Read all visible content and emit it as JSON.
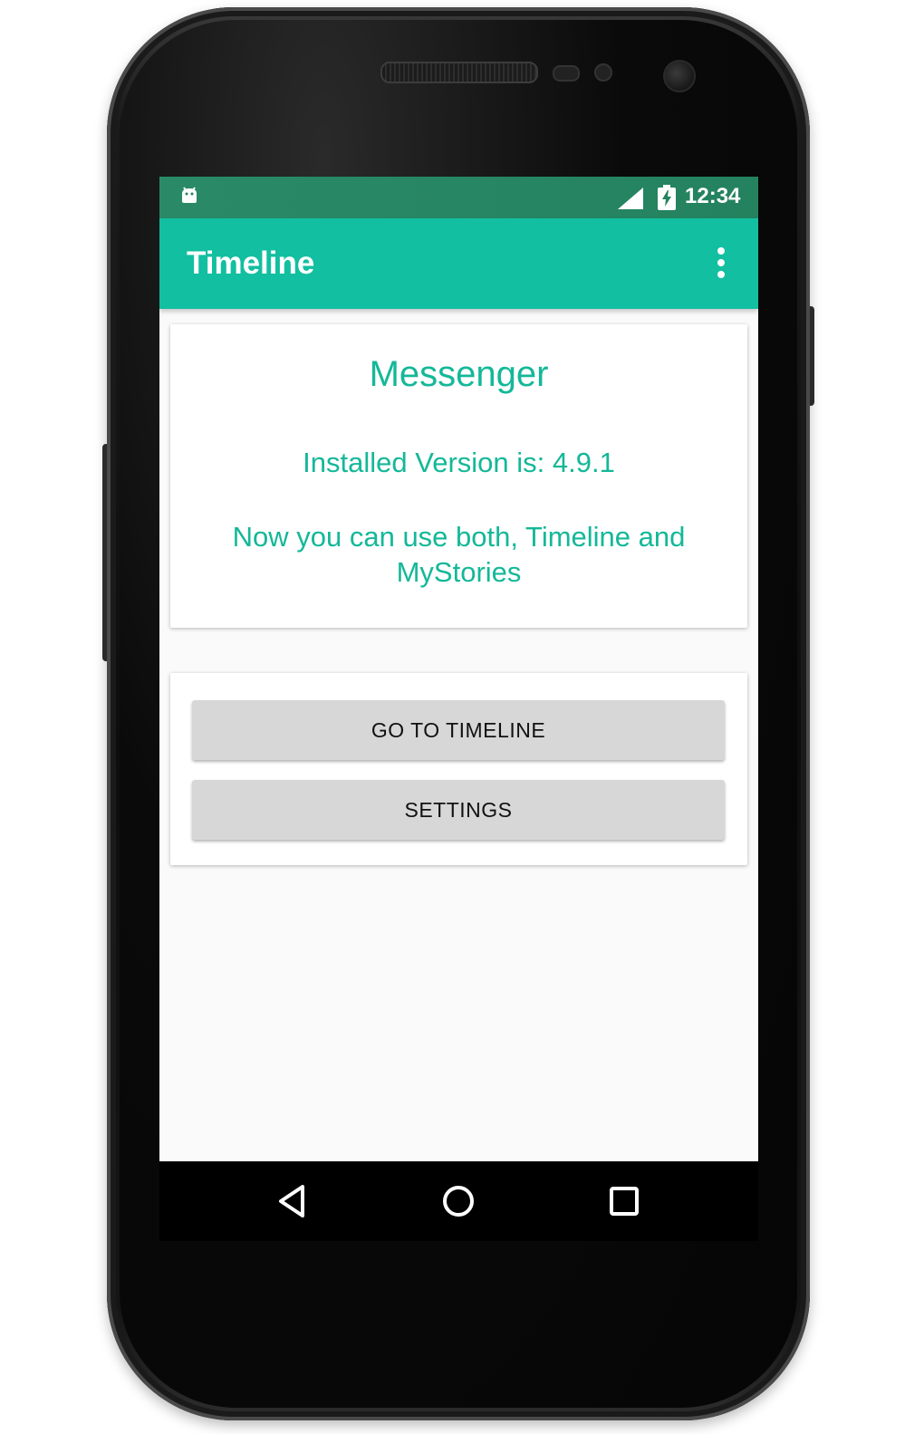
{
  "status_bar": {
    "time": "12:34",
    "notification_icon": "android-debug-icon",
    "signal_icon": "cell-signal-icon",
    "battery_icon": "battery-charging-icon"
  },
  "app_bar": {
    "title": "Timeline",
    "menu_icon": "more-vert-icon"
  },
  "info_card": {
    "title": "Messenger",
    "version_text": "Installed Version is: 4.9.1",
    "message": "Now you can use both, Timeline and MyStories"
  },
  "actions": {
    "go_to_timeline_label": "GO TO TIMELINE",
    "settings_label": "SETTINGS"
  },
  "nav_bar": {
    "back_icon": "back-triangle-icon",
    "home_icon": "home-circle-icon",
    "recents_icon": "recents-square-icon"
  },
  "colors": {
    "status_bar": "#24825f",
    "app_bar": "#12bfa0",
    "accent_text": "#14b898",
    "button_bg": "#d7d7d7",
    "screen_bg": "#fafafa"
  }
}
